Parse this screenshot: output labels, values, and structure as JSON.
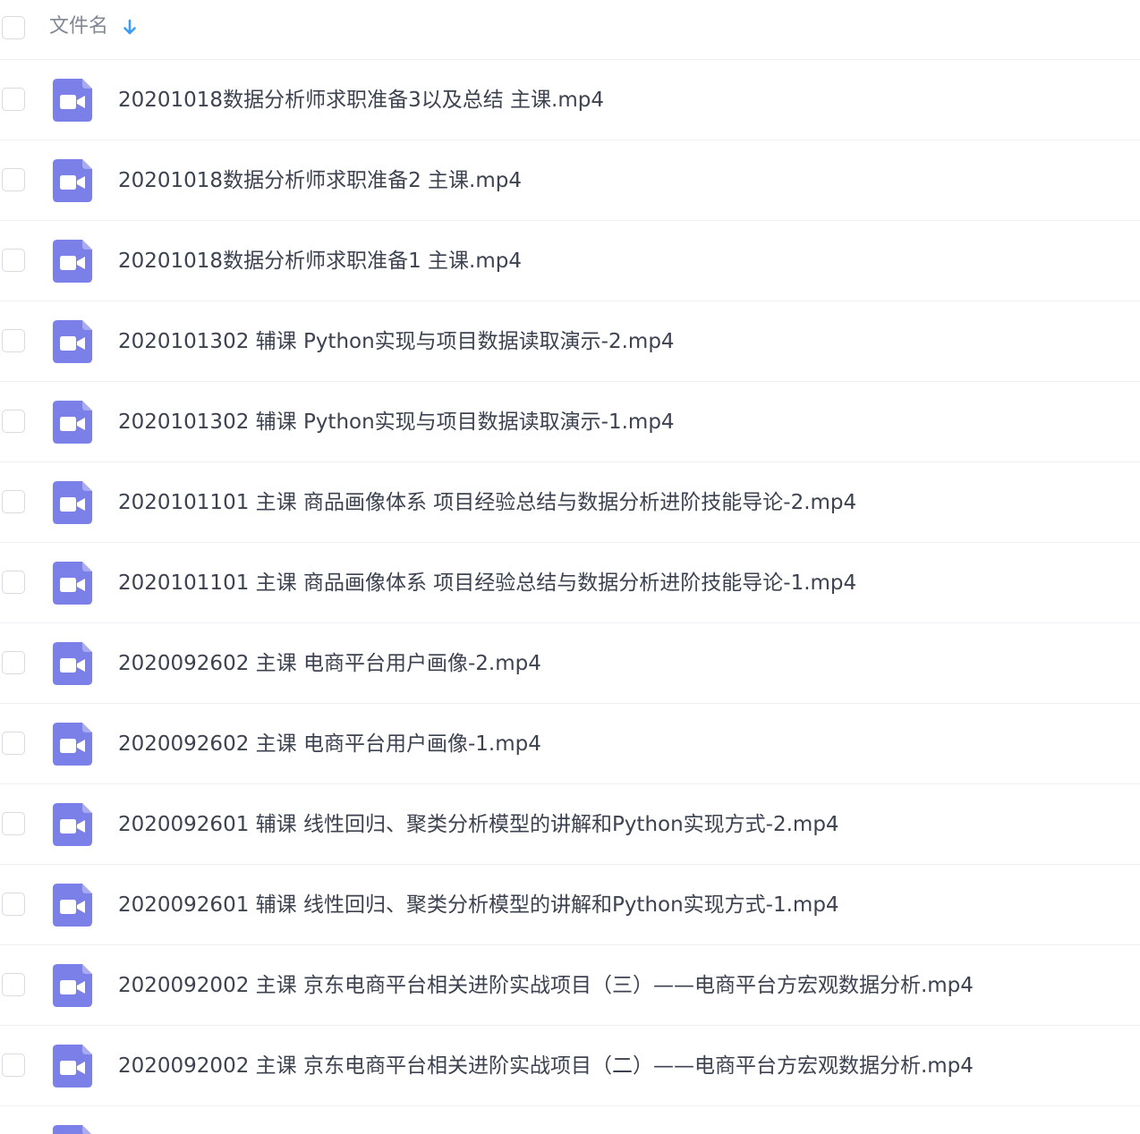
{
  "header": {
    "column_label": "文件名",
    "sort_icon": "arrow-down-icon",
    "sort_color": "#3a9cf5"
  },
  "file_icon": {
    "icon": "video-file-icon",
    "color": "#7b7fe8"
  },
  "files": [
    {
      "name": "20201018数据分析师求职准备3以及总结 主课.mp4"
    },
    {
      "name": "20201018数据分析师求职准备2 主课.mp4"
    },
    {
      "name": "20201018数据分析师求职准备1 主课.mp4"
    },
    {
      "name": "2020101302 辅课 Python实现与项目数据读取演示-2.mp4"
    },
    {
      "name": "2020101302 辅课 Python实现与项目数据读取演示-1.mp4"
    },
    {
      "name": "2020101101 主课 商品画像体系 项目经验总结与数据分析进阶技能导论-2.mp4"
    },
    {
      "name": "2020101101 主课 商品画像体系 项目经验总结与数据分析进阶技能导论-1.mp4"
    },
    {
      "name": "2020092602 主课 电商平台用户画像-2.mp4"
    },
    {
      "name": "2020092602 主课 电商平台用户画像-1.mp4"
    },
    {
      "name": "2020092601 辅课 线性回归、聚类分析模型的讲解和Python实现方式-2.mp4"
    },
    {
      "name": "2020092601 辅课 线性回归、聚类分析模型的讲解和Python实现方式-1.mp4"
    },
    {
      "name": "2020092002 主课 京东电商平台相关进阶实战项目（三）——电商平台方宏观数据分析.mp4"
    },
    {
      "name": "2020092002 主课 京东电商平台相关进阶实战项目（二）——电商平台方宏观数据分析.mp4"
    },
    {
      "name": ""
    }
  ]
}
